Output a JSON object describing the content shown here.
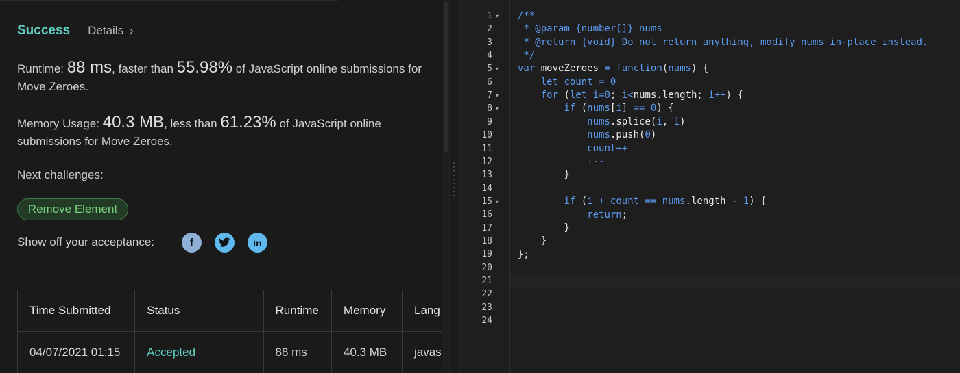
{
  "result": {
    "status": "Success",
    "details_label": "Details",
    "details_chevron": "›",
    "runtime_label": "Runtime:",
    "runtime_value": "88 ms",
    "runtime_mid": ", faster than",
    "runtime_percent": "55.98%",
    "runtime_tail": " of JavaScript online submissions for Move Zeroes.",
    "memory_label": "Memory Usage:",
    "memory_value": "40.3 MB",
    "memory_mid": ", less than",
    "memory_percent": "61.23%",
    "memory_tail": " of JavaScript online submissions for Move Zeroes.",
    "next_label": "Next challenges:",
    "next_challenge": "Remove Element",
    "showoff_label": "Show off your acceptance:",
    "social": [
      "facebook-icon",
      "twitter-icon",
      "linkedin-icon"
    ]
  },
  "submissions": {
    "headers": [
      "Time Submitted",
      "Status",
      "Runtime",
      "Memory",
      "Lang"
    ],
    "rows": [
      {
        "time": "04/07/2021 01:15",
        "status": "Accepted",
        "runtime": "88 ms",
        "memory": "40.3 MB",
        "lang": "javas"
      }
    ]
  },
  "editor": {
    "line_numbers": [
      "1",
      "2",
      "3",
      "4",
      "5",
      "6",
      "7",
      "8",
      "9",
      "10",
      "11",
      "12",
      "13",
      "14",
      "15",
      "16",
      "17",
      "18",
      "19",
      "20",
      "21",
      "22",
      "23",
      "24"
    ],
    "fold_lines": [
      "1",
      "5",
      "7",
      "8",
      "15"
    ],
    "fold_glyph": "▾",
    "active_line": "21"
  },
  "colors": {
    "accent_success": "#5fd0c1",
    "challenge_green": "#78d17f",
    "code_keyword": "#5b9bf0",
    "background": "#1a1a1a"
  }
}
